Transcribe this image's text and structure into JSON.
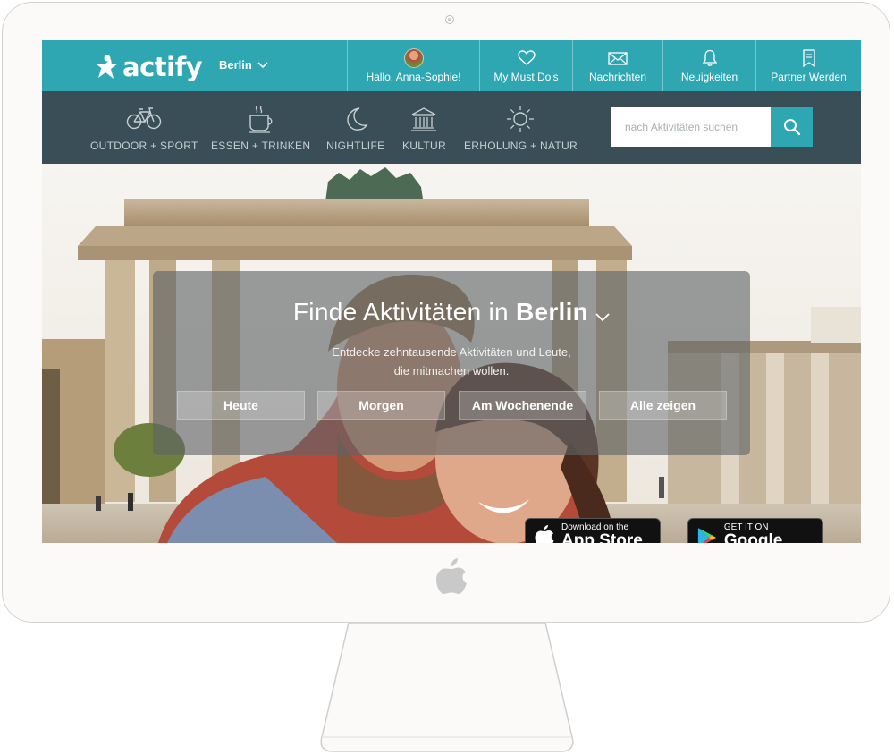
{
  "header": {
    "brand": "actify",
    "city_selector": "Berlin",
    "nav": {
      "greeting": "Hallo, Anna-Sophie!",
      "must_dos": "My Must Do's",
      "messages": "Nachrichten",
      "news": "Neuigkeiten",
      "partner": "Partner Werden"
    }
  },
  "categories": [
    {
      "label": "OUTDOOR + SPORT",
      "icon": "bicycle-icon"
    },
    {
      "label": "ESSEN + TRINKEN",
      "icon": "coffee-cup-icon"
    },
    {
      "label": "NIGHTLIFE",
      "icon": "moon-icon"
    },
    {
      "label": "KULTUR",
      "icon": "museum-icon"
    },
    {
      "label": "ERHOLUNG + NATUR",
      "icon": "sun-icon"
    }
  ],
  "search": {
    "placeholder": "nach Aktivitäten suchen",
    "button_icon": "search-icon"
  },
  "hero": {
    "title_prefix": "Finde Aktivitäten in",
    "city": "Berlin",
    "subtitle_line1": "Entdecke zehntausende Aktivitäten und Leute,",
    "subtitle_line2": "die mitmachen wollen.",
    "buttons": [
      "Heute",
      "Morgen",
      "Am Wochenende",
      "Alle zeigen"
    ]
  },
  "app_badges": {
    "appstore_small": "Download on the",
    "appstore_big": "App Store",
    "googleplay_small": "GET IT ON",
    "googleplay_big": "Google Play"
  },
  "colors": {
    "primary": "#2fa7b3",
    "category_bar": "#3a4e57",
    "frame": "#fbfaf8"
  }
}
